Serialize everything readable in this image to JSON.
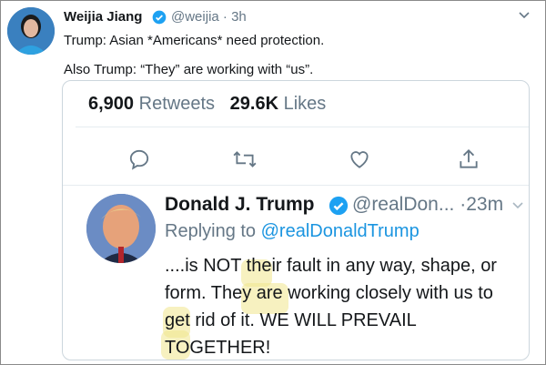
{
  "outer_tweet": {
    "name": "Weijia Jiang",
    "handle": "@weijia",
    "time": "· 3h",
    "lines": [
      "Trump: Asian *Americans* need protection.",
      "Also Trump: “They” are working with “us”."
    ]
  },
  "embedded_tweet": {
    "retweets_count": "6,900",
    "retweets_label": "Retweets",
    "likes_count": "29.6K",
    "likes_label": "Likes",
    "name": "Donald J. Trump",
    "handle": "@realDon...",
    "time": "·23m",
    "replying_prefix": "Replying to",
    "replying_handle": "@realDonaldTrump",
    "text": "....is NOT their fault in any way, shape, or form. They are working closely with us to get rid of it. WE WILL PREVAIL TOGETHER!"
  },
  "colors": {
    "verified_blue": "#1da1f2",
    "link_blue": "#1b95e0",
    "gray_text": "#657786",
    "highlight": "#f0e68c"
  },
  "icons": [
    "reply-icon",
    "retweet-icon",
    "like-icon",
    "share-icon",
    "verified-icon",
    "chevron-down-icon"
  ]
}
